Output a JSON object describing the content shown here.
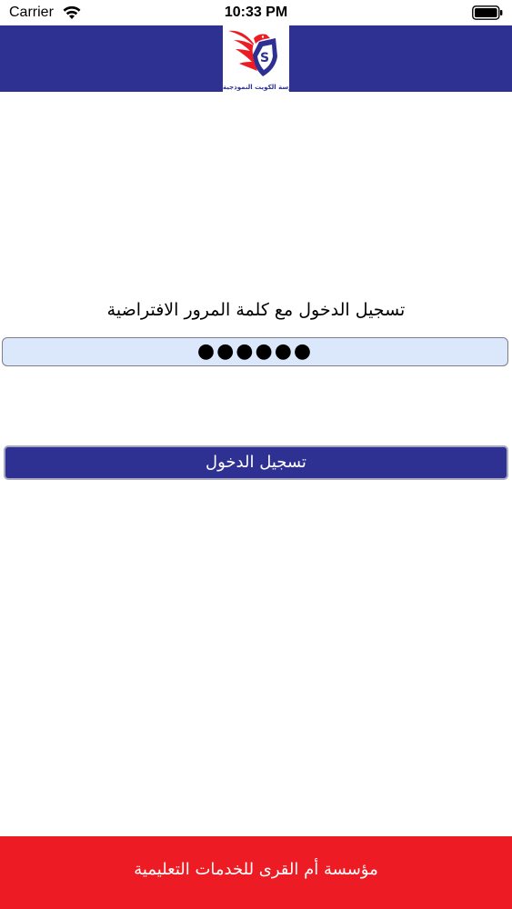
{
  "status_bar": {
    "carrier": "Carrier",
    "time": "10:33 PM",
    "wifi_icon": "wifi-icon",
    "battery_icon": "battery-full-icon"
  },
  "header": {
    "background_color": "#2e3192",
    "logo_caption": "مدرسة الكويت النموذجية",
    "logo_icon": "eagle-shield-logo"
  },
  "login": {
    "title": "تسجيل الدخول مع كلمة المرور الافتراضية",
    "password_value": "●●●●●●",
    "button_label": "تسجيل الدخول",
    "button_color": "#2e3192",
    "field_color": "#dbe8fc"
  },
  "footer": {
    "text": "مؤسسة أم القرى للخدمات التعليمية",
    "background_color": "#ed1c24"
  }
}
